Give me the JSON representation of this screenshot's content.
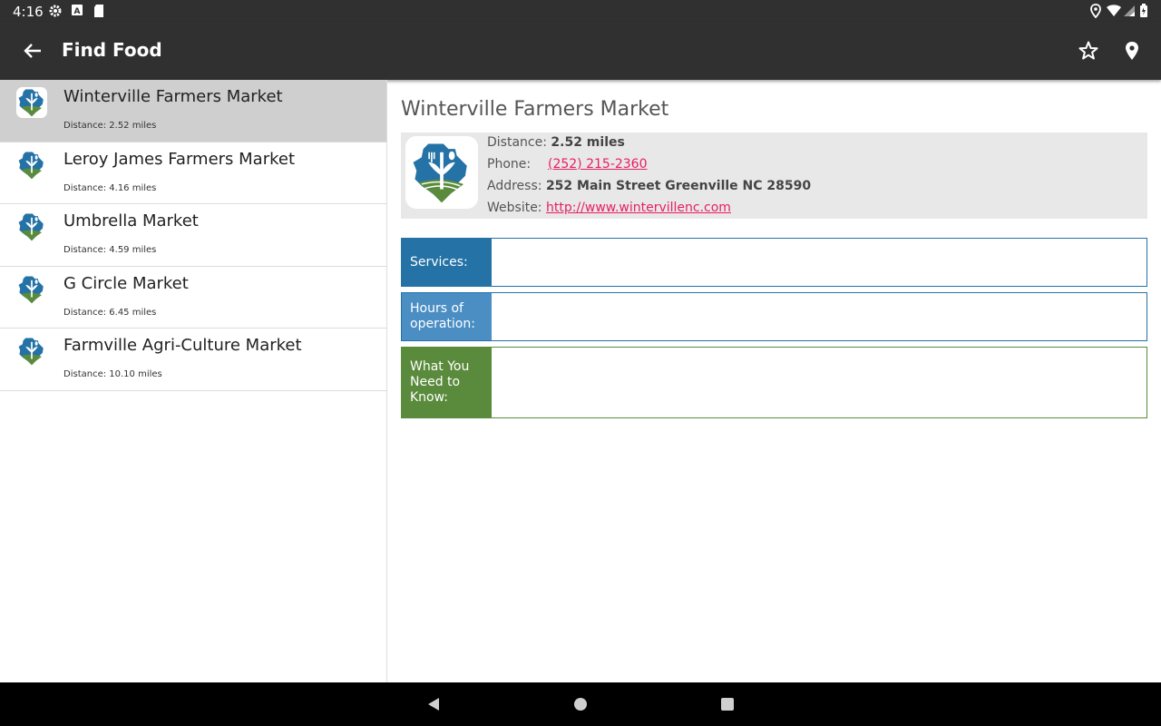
{
  "status_bar": {
    "time": "4:16",
    "icons": [
      "settings-icon",
      "a-badge-icon",
      "sd-card-icon",
      "location-icon",
      "wifi-icon",
      "signal-icon",
      "battery-icon"
    ]
  },
  "app_bar": {
    "title": "Find Food",
    "icons": {
      "back": "arrow-back-icon",
      "favorite": "star-outline-icon",
      "map": "map-pin-icon"
    }
  },
  "list": {
    "items": [
      {
        "name": "Winterville Farmers Market",
        "distance": "Distance: 2.52 miles",
        "selected": true
      },
      {
        "name": "Leroy James Farmers Market",
        "distance": "Distance: 4.16 miles",
        "selected": false
      },
      {
        "name": "Umbrella Market",
        "distance": "Distance: 4.59 miles",
        "selected": false
      },
      {
        "name": "G Circle Market",
        "distance": "Distance: 6.45 miles",
        "selected": false
      },
      {
        "name": "Farmville Agri-Culture Market",
        "distance": "Distance: 10.10 miles",
        "selected": false
      }
    ]
  },
  "detail": {
    "title": "Winterville Farmers Market",
    "distance_label": "Distance:",
    "distance_value": "2.52 miles",
    "phone_label": "Phone:",
    "phone_value": "(252) 215-2360",
    "address_label": "Address:",
    "address_value": "252 Main Street Greenville NC 28590",
    "website_label": "Website:",
    "website_value": "http://www.wintervillenc.com",
    "sections": [
      {
        "label": "Services:",
        "body": ""
      },
      {
        "label": "Hours of operation:",
        "body": ""
      },
      {
        "label": "What You Need to Know:",
        "body": ""
      }
    ]
  },
  "colors": {
    "app_bar": "#303030",
    "selected_row": "#cfcfcf",
    "link": "#e91e63",
    "services": "#2472a6",
    "hours": "#4a8ec4",
    "need_to_know": "#5a8b3c"
  },
  "nav_bar": {
    "icons": [
      "back-triangle-icon",
      "home-circle-icon",
      "recents-square-icon"
    ]
  }
}
